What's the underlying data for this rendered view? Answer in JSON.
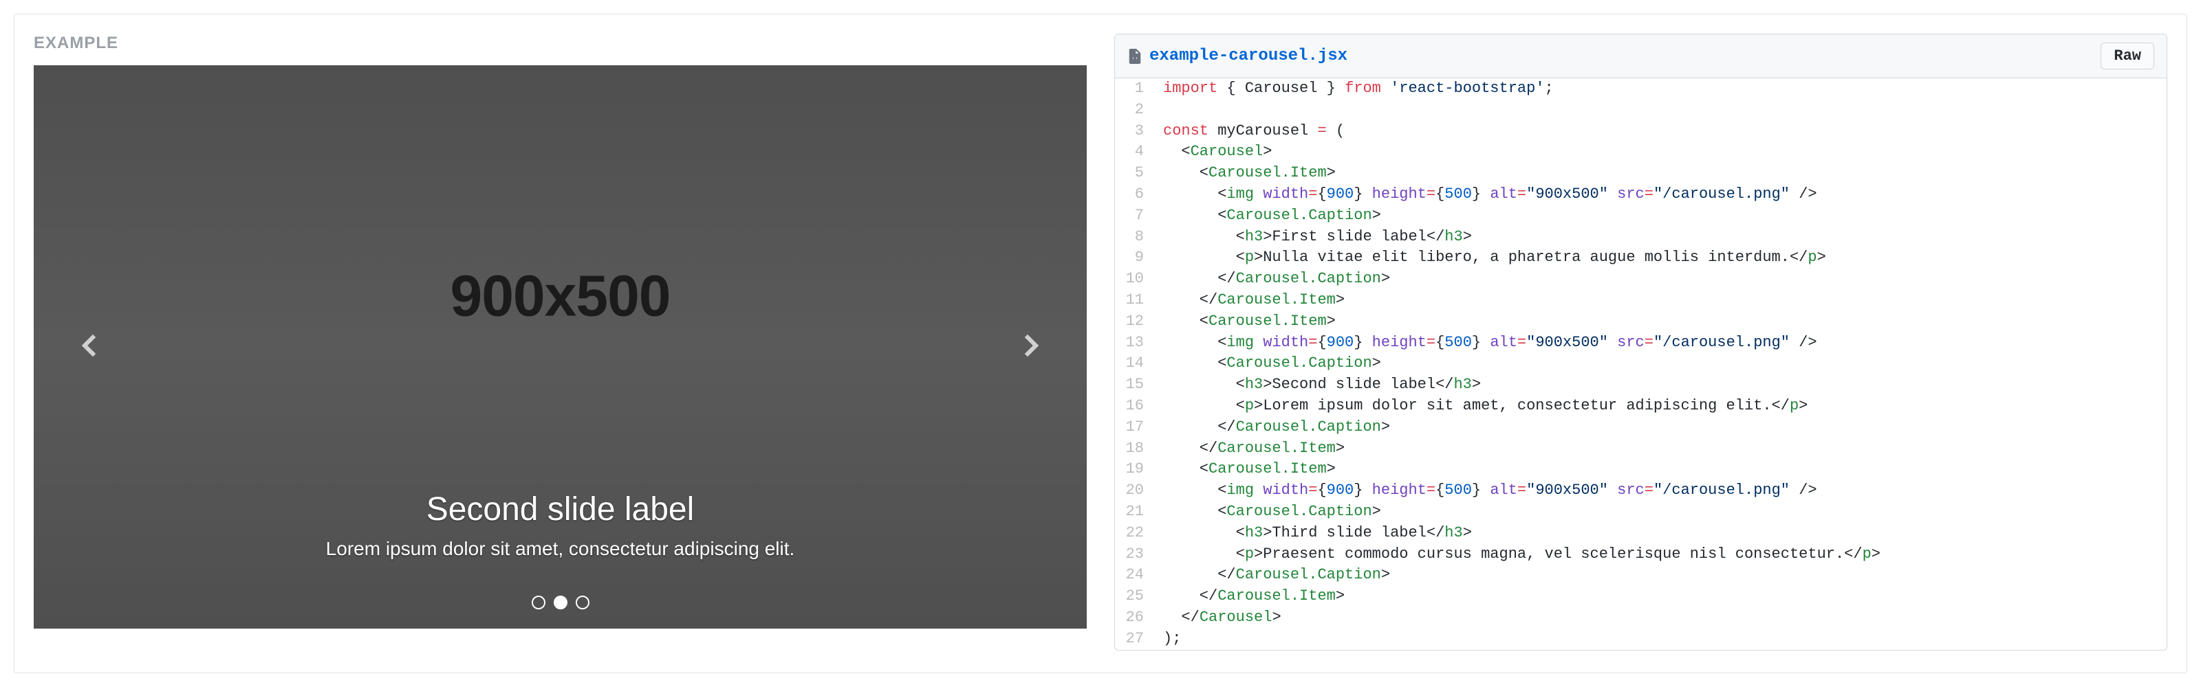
{
  "example_label": "EXAMPLE",
  "carousel": {
    "placeholder": "900x500",
    "active_index": 1,
    "indicator_count": 3,
    "caption": {
      "title": "Second slide label",
      "text": "Lorem ipsum dolor sit amet, consectetur adipiscing elit."
    }
  },
  "code": {
    "filename": "example-carousel.jsx",
    "raw_label": "Raw",
    "tokens": [
      [
        [
          "import",
          "kw"
        ],
        [
          " { Carousel } ",
          ""
        ],
        [
          "from",
          "kw"
        ],
        [
          " ",
          ""
        ],
        [
          "'react-bootstrap'",
          "str"
        ],
        [
          ";",
          ""
        ]
      ],
      [],
      [
        [
          "const",
          "kw"
        ],
        [
          " myCarousel ",
          ""
        ],
        [
          "=",
          "kw"
        ],
        [
          " (",
          ""
        ]
      ],
      [
        [
          "  <",
          ""
        ],
        [
          "Carousel",
          "tag"
        ],
        [
          ">",
          ""
        ]
      ],
      [
        [
          "    <",
          ""
        ],
        [
          "Carousel.Item",
          "tag"
        ],
        [
          ">",
          ""
        ]
      ],
      [
        [
          "      <",
          ""
        ],
        [
          "img",
          "tag"
        ],
        [
          " ",
          ""
        ],
        [
          "width",
          "attr"
        ],
        [
          "=",
          "kw"
        ],
        [
          "{",
          ""
        ],
        [
          "900",
          "num"
        ],
        [
          "}",
          ""
        ],
        [
          " ",
          ""
        ],
        [
          "height",
          "attr"
        ],
        [
          "=",
          "kw"
        ],
        [
          "{",
          ""
        ],
        [
          "500",
          "num"
        ],
        [
          "}",
          ""
        ],
        [
          " ",
          ""
        ],
        [
          "alt",
          "attr"
        ],
        [
          "=",
          "kw"
        ],
        [
          "\"900x500\"",
          "str"
        ],
        [
          " ",
          ""
        ],
        [
          "src",
          "attr"
        ],
        [
          "=",
          "kw"
        ],
        [
          "\"/carousel.png\"",
          "str"
        ],
        [
          " />",
          ""
        ]
      ],
      [
        [
          "      <",
          ""
        ],
        [
          "Carousel.Caption",
          "tag"
        ],
        [
          ">",
          ""
        ]
      ],
      [
        [
          "        <",
          ""
        ],
        [
          "h3",
          "tag"
        ],
        [
          ">First slide label</",
          ""
        ],
        [
          "h3",
          "tag"
        ],
        [
          ">",
          ""
        ]
      ],
      [
        [
          "        <",
          ""
        ],
        [
          "p",
          "tag"
        ],
        [
          ">Nulla vitae elit libero, a pharetra augue mollis interdum.</",
          ""
        ],
        [
          "p",
          "tag"
        ],
        [
          ">",
          ""
        ]
      ],
      [
        [
          "      </",
          ""
        ],
        [
          "Carousel.Caption",
          "tag"
        ],
        [
          ">",
          ""
        ]
      ],
      [
        [
          "    </",
          ""
        ],
        [
          "Carousel.Item",
          "tag"
        ],
        [
          ">",
          ""
        ]
      ],
      [
        [
          "    <",
          ""
        ],
        [
          "Carousel.Item",
          "tag"
        ],
        [
          ">",
          ""
        ]
      ],
      [
        [
          "      <",
          ""
        ],
        [
          "img",
          "tag"
        ],
        [
          " ",
          ""
        ],
        [
          "width",
          "attr"
        ],
        [
          "=",
          "kw"
        ],
        [
          "{",
          ""
        ],
        [
          "900",
          "num"
        ],
        [
          "}",
          ""
        ],
        [
          " ",
          ""
        ],
        [
          "height",
          "attr"
        ],
        [
          "=",
          "kw"
        ],
        [
          "{",
          ""
        ],
        [
          "500",
          "num"
        ],
        [
          "}",
          ""
        ],
        [
          " ",
          ""
        ],
        [
          "alt",
          "attr"
        ],
        [
          "=",
          "kw"
        ],
        [
          "\"900x500\"",
          "str"
        ],
        [
          " ",
          ""
        ],
        [
          "src",
          "attr"
        ],
        [
          "=",
          "kw"
        ],
        [
          "\"/carousel.png\"",
          "str"
        ],
        [
          " />",
          ""
        ]
      ],
      [
        [
          "      <",
          ""
        ],
        [
          "Carousel.Caption",
          "tag"
        ],
        [
          ">",
          ""
        ]
      ],
      [
        [
          "        <",
          ""
        ],
        [
          "h3",
          "tag"
        ],
        [
          ">Second slide label</",
          ""
        ],
        [
          "h3",
          "tag"
        ],
        [
          ">",
          ""
        ]
      ],
      [
        [
          "        <",
          ""
        ],
        [
          "p",
          "tag"
        ],
        [
          ">Lorem ipsum dolor sit amet, consectetur adipiscing elit.</",
          ""
        ],
        [
          "p",
          "tag"
        ],
        [
          ">",
          ""
        ]
      ],
      [
        [
          "      </",
          ""
        ],
        [
          "Carousel.Caption",
          "tag"
        ],
        [
          ">",
          ""
        ]
      ],
      [
        [
          "    </",
          ""
        ],
        [
          "Carousel.Item",
          "tag"
        ],
        [
          ">",
          ""
        ]
      ],
      [
        [
          "    <",
          ""
        ],
        [
          "Carousel.Item",
          "tag"
        ],
        [
          ">",
          ""
        ]
      ],
      [
        [
          "      <",
          ""
        ],
        [
          "img",
          "tag"
        ],
        [
          " ",
          ""
        ],
        [
          "width",
          "attr"
        ],
        [
          "=",
          "kw"
        ],
        [
          "{",
          ""
        ],
        [
          "900",
          "num"
        ],
        [
          "}",
          ""
        ],
        [
          " ",
          ""
        ],
        [
          "height",
          "attr"
        ],
        [
          "=",
          "kw"
        ],
        [
          "{",
          ""
        ],
        [
          "500",
          "num"
        ],
        [
          "}",
          ""
        ],
        [
          " ",
          ""
        ],
        [
          "alt",
          "attr"
        ],
        [
          "=",
          "kw"
        ],
        [
          "\"900x500\"",
          "str"
        ],
        [
          " ",
          ""
        ],
        [
          "src",
          "attr"
        ],
        [
          "=",
          "kw"
        ],
        [
          "\"/carousel.png\"",
          "str"
        ],
        [
          " />",
          ""
        ]
      ],
      [
        [
          "      <",
          ""
        ],
        [
          "Carousel.Caption",
          "tag"
        ],
        [
          ">",
          ""
        ]
      ],
      [
        [
          "        <",
          ""
        ],
        [
          "h3",
          "tag"
        ],
        [
          ">Third slide label</",
          ""
        ],
        [
          "h3",
          "tag"
        ],
        [
          ">",
          ""
        ]
      ],
      [
        [
          "        <",
          ""
        ],
        [
          "p",
          "tag"
        ],
        [
          ">Praesent commodo cursus magna, vel scelerisque nisl consectetur.</",
          ""
        ],
        [
          "p",
          "tag"
        ],
        [
          ">",
          ""
        ]
      ],
      [
        [
          "      </",
          ""
        ],
        [
          "Carousel.Caption",
          "tag"
        ],
        [
          ">",
          ""
        ]
      ],
      [
        [
          "    </",
          ""
        ],
        [
          "Carousel.Item",
          "tag"
        ],
        [
          ">",
          ""
        ]
      ],
      [
        [
          "  </",
          ""
        ],
        [
          "Carousel",
          "tag"
        ],
        [
          ">",
          ""
        ]
      ],
      [
        [
          ");",
          ""
        ]
      ]
    ]
  }
}
